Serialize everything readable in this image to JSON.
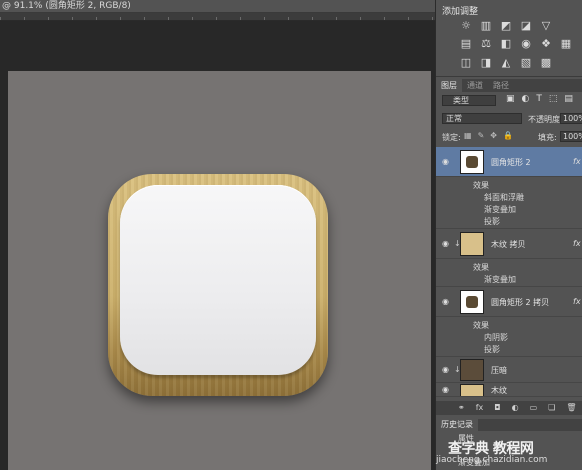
{
  "document": {
    "tab_title": "@ 91.1% (圆角矩形 2, RGB/8)"
  },
  "adjustments": {
    "title": "添加调整",
    "row1_icons": [
      "brightness-icon",
      "levels-icon",
      "curves-icon",
      "exposure-icon",
      "vibrance-icon"
    ],
    "row2_icons": [
      "hue-icon",
      "balance-icon",
      "bw-icon",
      "photo-filter-icon",
      "channel-mixer-icon",
      "lookup-icon"
    ],
    "row3_icons": [
      "invert-icon",
      "posterize-icon",
      "threshold-icon",
      "gradient-map-icon",
      "selective-color-icon"
    ]
  },
  "layers_panel": {
    "tabs": [
      {
        "label": "图层",
        "active": true
      },
      {
        "label": "通道",
        "active": false
      },
      {
        "label": "路径",
        "active": false
      }
    ],
    "filter_label": "类型",
    "blend_mode": "正常",
    "opacity_label": "不透明度:",
    "opacity_value": "100%",
    "lock_label": "锁定:",
    "fill_label": "填充:",
    "fill_value": "100%",
    "layers": [
      {
        "name": "圆角矩形 2",
        "fx": "fx",
        "selected": true,
        "thumb": "shape",
        "effects_label": "效果",
        "effects": [
          "斜面和浮雕",
          "渐变叠加",
          "投影"
        ]
      },
      {
        "name": "木纹 拷贝",
        "fx": "fx",
        "selected": false,
        "thumb": "wood",
        "effects_label": "效果",
        "effects": [
          "渐变叠加"
        ]
      },
      {
        "name": "圆角矩形 2 拷贝",
        "fx": "fx",
        "selected": false,
        "thumb": "shape",
        "effects_label": "效果",
        "effects": [
          "内阴影",
          "投影"
        ]
      },
      {
        "name": "压暗",
        "fx": "",
        "selected": false,
        "thumb": "dark"
      },
      {
        "name": "木纹",
        "fx": "",
        "selected": false,
        "thumb": "wood"
      }
    ]
  },
  "history": {
    "tab_label": "历史记录",
    "items": [
      "属性",
      "渐变叠加"
    ]
  },
  "watermark": {
    "brand": "查字典 教程网",
    "url": "jiaocheng.chazidian.com"
  },
  "colors": {
    "selected_layer": "#5f7ba3",
    "panel": "#535353",
    "canvas": "#767372",
    "wood": "#d2b878"
  }
}
